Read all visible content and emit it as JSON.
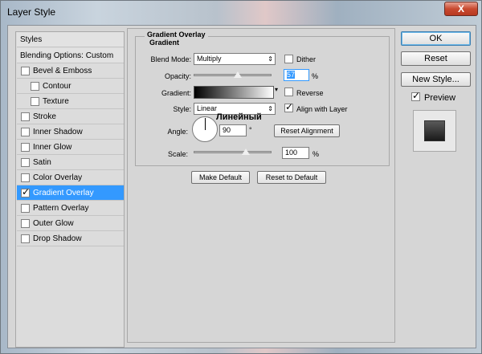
{
  "window": {
    "title": "Layer Style",
    "close_label": "X"
  },
  "styles_list": {
    "header": "Styles",
    "blending": "Blending Options: Custom",
    "items": [
      {
        "label": "Bevel & Emboss",
        "checked": false,
        "indent": 0
      },
      {
        "label": "Contour",
        "checked": false,
        "indent": 1
      },
      {
        "label": "Texture",
        "checked": false,
        "indent": 1
      },
      {
        "label": "Stroke",
        "checked": false,
        "indent": 0
      },
      {
        "label": "Inner Shadow",
        "checked": false,
        "indent": 0
      },
      {
        "label": "Inner Glow",
        "checked": false,
        "indent": 0
      },
      {
        "label": "Satin",
        "checked": false,
        "indent": 0
      },
      {
        "label": "Color Overlay",
        "checked": false,
        "indent": 0
      },
      {
        "label": "Gradient Overlay",
        "checked": true,
        "indent": 0,
        "selected": true
      },
      {
        "label": "Pattern Overlay",
        "checked": false,
        "indent": 0
      },
      {
        "label": "Outer Glow",
        "checked": false,
        "indent": 0
      },
      {
        "label": "Drop Shadow",
        "checked": false,
        "indent": 0
      }
    ]
  },
  "panel": {
    "group_title": "Gradient Overlay",
    "sub_title": "Gradient",
    "blend_mode_label": "Blend Mode:",
    "blend_mode_value": "Multiply",
    "dither_label": "Dither",
    "opacity_label": "Opacity:",
    "opacity_value": "57",
    "opacity_level": 57,
    "percent": "%",
    "gradient_label": "Gradient:",
    "reverse_label": "Reverse",
    "style_label": "Style:",
    "style_value": "Linear",
    "align_label": "Align with Layer",
    "align_checked": true,
    "angle_label": "Angle:",
    "angle_value": "90",
    "degree": "°",
    "reset_alignment": "Reset Alignment",
    "scale_label": "Scale:",
    "scale_value": "100",
    "scale_level": 100,
    "make_default": "Make Default",
    "reset_default": "Reset to Default",
    "annotation": "Линейный"
  },
  "right_buttons": {
    "ok": "OK",
    "reset": "Reset",
    "new_style": "New Style...",
    "preview_label": "Preview",
    "preview_checked": true
  },
  "colors": {
    "selection": "#3399ff",
    "gradient_start": "#000000",
    "gradient_end": "#ffffff"
  }
}
